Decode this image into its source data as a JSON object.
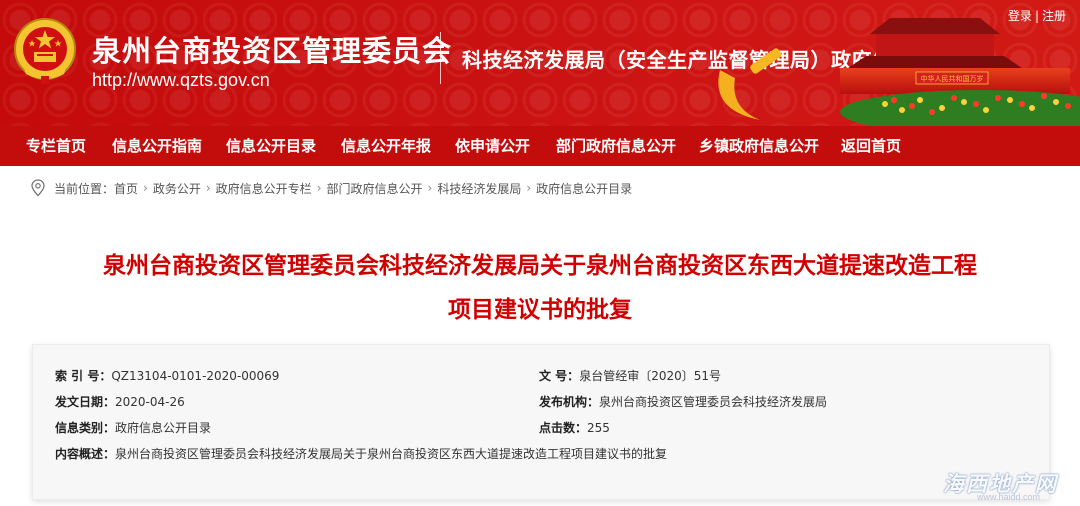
{
  "header": {
    "site_title": "泉州台商投资区管理委员会",
    "site_url": "http://www.qzts.gov.cn",
    "column_title": "科技经济发展局（安全生产监督管理局）政府信息公开专栏",
    "login": "登录",
    "separator": "|",
    "register": "注册",
    "gate_sign": "中华人民共和国万岁"
  },
  "nav": {
    "items": [
      {
        "label": "专栏首页"
      },
      {
        "label": "信息公开指南"
      },
      {
        "label": "信息公开目录"
      },
      {
        "label": "信息公开年报"
      },
      {
        "label": "依申请公开"
      },
      {
        "label": "部门政府信息公开"
      },
      {
        "label": "乡镇政府信息公开"
      },
      {
        "label": "返回首页"
      }
    ]
  },
  "breadcrumb": {
    "prefix": "当前位置：",
    "separator": "›",
    "items": [
      "首页",
      "政务公开",
      "政府信息公开专栏",
      "部门政府信息公开",
      "科技经济发展局",
      "政府信息公开目录"
    ]
  },
  "article": {
    "title_line1": "泉州台商投资区管理委员会科技经济发展局关于泉州台商投资区东西大道提速改造工程",
    "title_line2": "项目建议书的批复"
  },
  "meta": {
    "index_label": "索 引 号：",
    "index_value": "QZ13104-0101-2020-00069",
    "doc_no_label": "文   号：",
    "doc_no_value": "泉台管经审〔2020〕51号",
    "date_label": "发文日期：",
    "date_value": "2020-04-26",
    "issuer_label": "发布机构：",
    "issuer_value": "泉州台商投资区管理委员会科技经济发展局",
    "category_label": "信息类别：",
    "category_value": "政府信息公开目录",
    "clicks_label": "点击数：",
    "clicks_value": "255",
    "summary_label": "内容概述：",
    "summary_value": "泉州台商投资区管理委员会科技经济发展局关于泉州台商投资区东西大道提速改造工程项目建议书的批复"
  },
  "watermark": {
    "text": "海西地产网",
    "sub": "www.haidd.com"
  },
  "colors": {
    "brand_red": "#c30d0d",
    "title_red": "#d10000",
    "emblem_gold": "#f5c431"
  },
  "icons": {
    "location": "map-pin-icon",
    "emblem": "national-emblem-icon"
  }
}
